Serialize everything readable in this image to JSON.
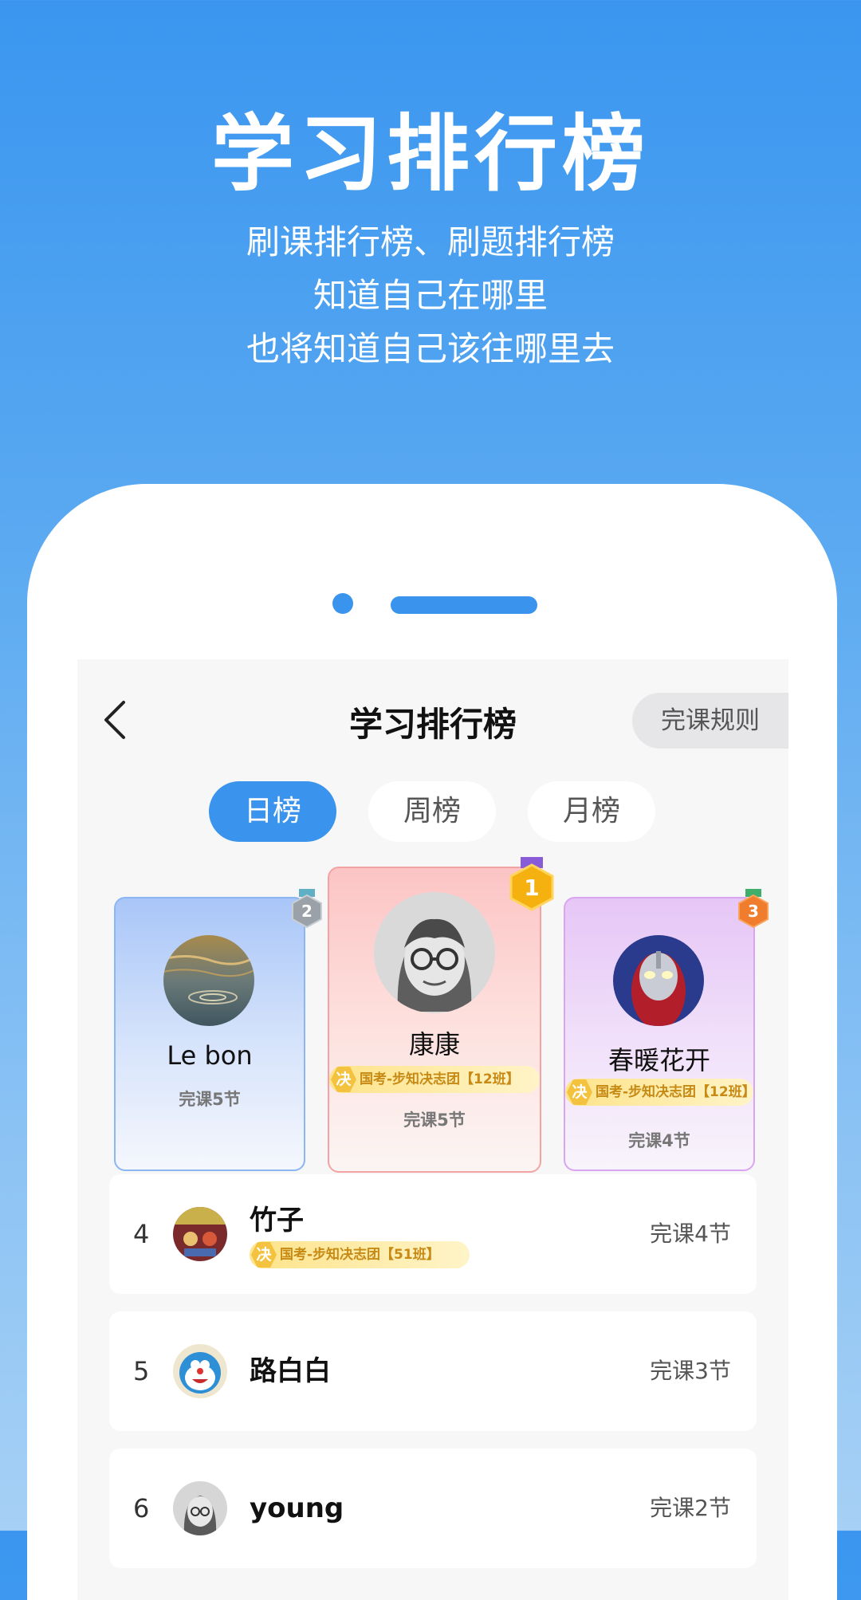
{
  "promo": {
    "title": "学习排行榜",
    "lines": [
      "刷课排行榜、刷题排行榜",
      "知道自己在哪里",
      "也将知道自己该往哪里去"
    ]
  },
  "header": {
    "title": "学习排行榜",
    "rule_button": "完课规则",
    "back_icon": "chevron-left-icon"
  },
  "tabs": [
    {
      "label": "日榜",
      "active": true
    },
    {
      "label": "周榜",
      "active": false
    },
    {
      "label": "月榜",
      "active": false
    }
  ],
  "podium": [
    {
      "rank": "1",
      "name": "康康",
      "count": "完课5节",
      "group": "国考-步知决志团【12班】"
    },
    {
      "rank": "2",
      "name": "Le bon",
      "count": "完课5节"
    },
    {
      "rank": "3",
      "name": "春暖花开",
      "count": "完课4节",
      "group": "国考-步知决志团【12班】"
    }
  ],
  "group_badge": "决",
  "list": [
    {
      "rank": "4",
      "name": "竹子",
      "count": "完课4节",
      "group": "国考-步知决志团【51班】"
    },
    {
      "rank": "5",
      "name": "路白白",
      "count": "完课3节"
    },
    {
      "rank": "6",
      "name": "young",
      "count": "完课2节"
    }
  ],
  "colors": {
    "accent": "#3a93ec",
    "gold": "#f5b10f",
    "silver": "#9aa1a8",
    "bronze": "#f07c2e",
    "tag_text": "#c78a14"
  }
}
